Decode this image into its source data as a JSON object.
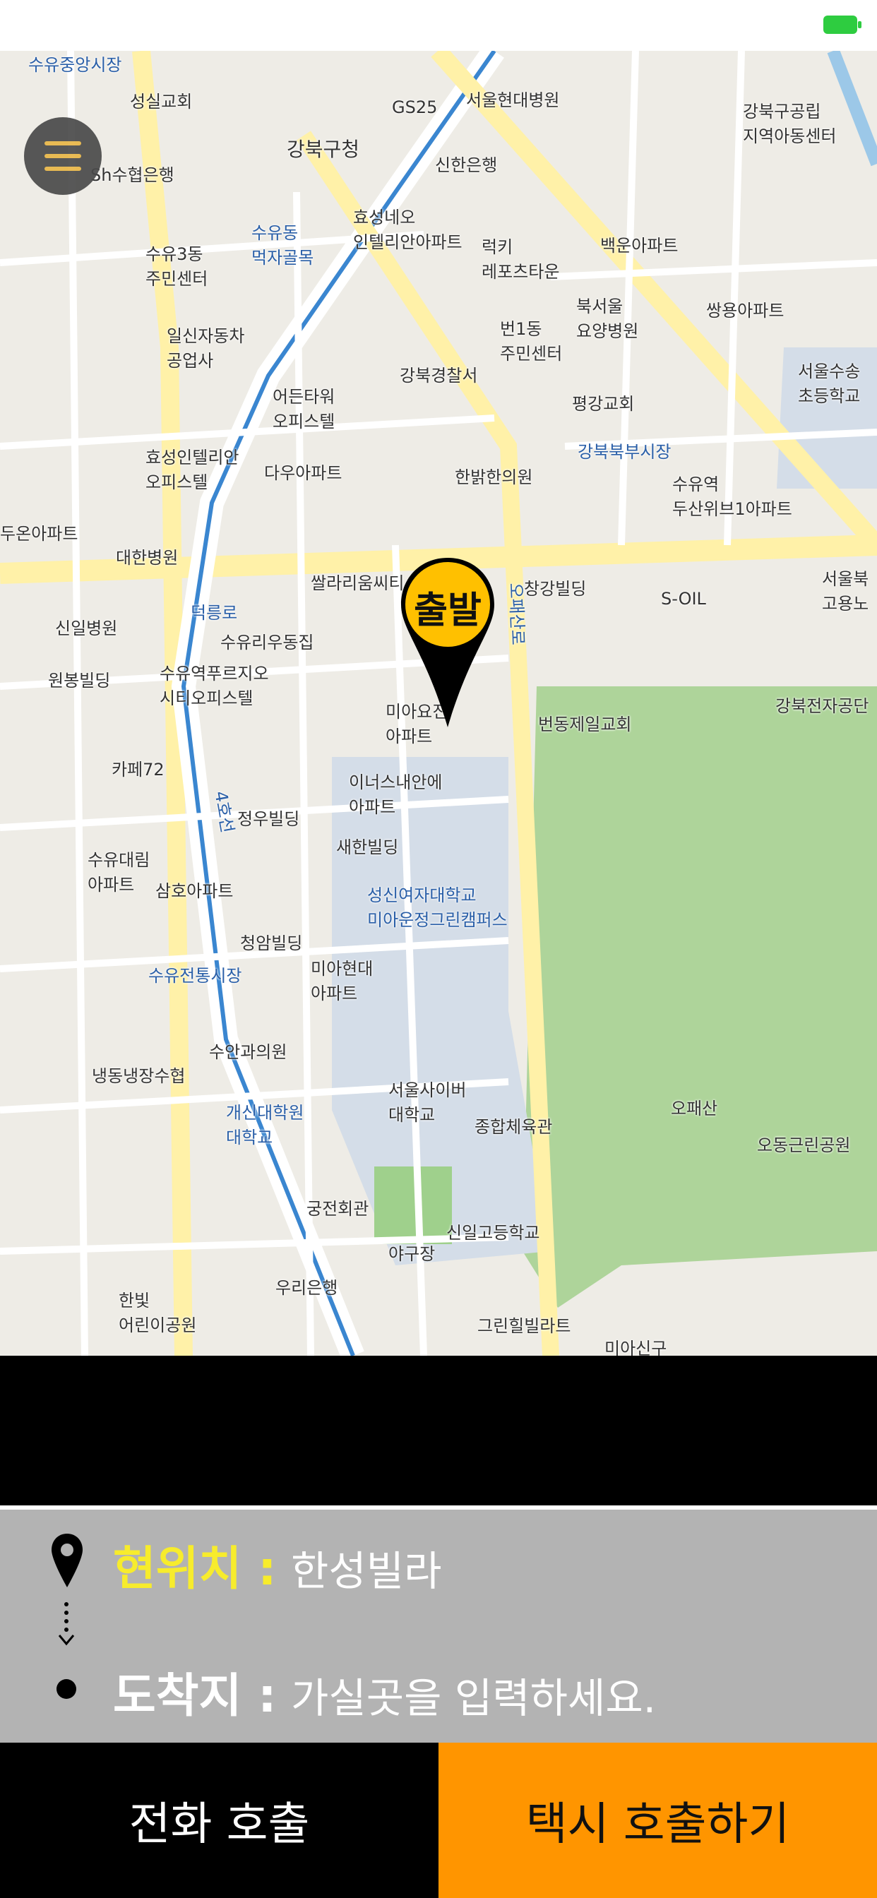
{
  "status": {
    "battery_icon": "battery-charging-icon"
  },
  "map": {
    "labels": [
      "수유중앙시장",
      "성실교회",
      "GS25",
      "서울현대병원",
      "강북구공립 지역아동센터",
      "강북구청",
      "Sh수협은행",
      "신한은행",
      "효성네오 인텔리안아파트",
      "수유동 먹자골목",
      "수유3동 주민센터",
      "럭키 레포츠타운",
      "백운아파트",
      "북서울 요양병원",
      "쌍용아파트",
      "서울수송 초등학교",
      "일신자동차 공업사",
      "번1동 주민센터",
      "강북경찰서",
      "평강교회",
      "어든타워 오피스텔",
      "효성인텔리안 오피스텔",
      "다우아파트",
      "한밝한의원",
      "강북북부시장",
      "수유역 두산위브1아파트",
      "두온아파트",
      "대한병원",
      "쌀라리움씨티",
      "창강빌딩",
      "S-OIL",
      "서울북 고용노",
      "신일병원",
      "수유리우동집",
      "원봉빌딩",
      "수유역푸르지오 시티오피스텔",
      "미아요진 아파트",
      "번동제일교회",
      "강북전자공단",
      "카페72",
      "이너스내안에 아파트",
      "정우빌딩",
      "새한빌딩",
      "수유대림 아파트",
      "삼호아파트",
      "성신여자대학교 미아운정그린캠퍼스",
      "청암빌딩",
      "미아현대 아파트",
      "수유전통시장",
      "수안과의원",
      "냉동냉장수협",
      "개신대학원 대학교",
      "서울사이버 대학교",
      "종합체육관",
      "오패산",
      "오동근린공원",
      "궁전회관",
      "야구장",
      "신일고등학교",
      "우리은행",
      "한빛 어린이공원",
      "그린힐빌라트",
      "미아신구",
      "4호선",
      "덕릉로",
      "오패산로"
    ],
    "pin_label": "출발",
    "menu_icon": "hamburger-menu-icon"
  },
  "panel": {
    "current_label": "현위치 :",
    "current_value": "한성빌라",
    "dest_label": "도착지 :",
    "dest_placeholder": "가실곳을 입력하세요."
  },
  "buttons": {
    "call": "전화 호출",
    "taxi": "택시 호출하기"
  },
  "colors": {
    "accent": "#ff9500",
    "pin": "#ffc000",
    "current_label": "#f7ec2c",
    "panel_bg": "#b3b3b3"
  }
}
